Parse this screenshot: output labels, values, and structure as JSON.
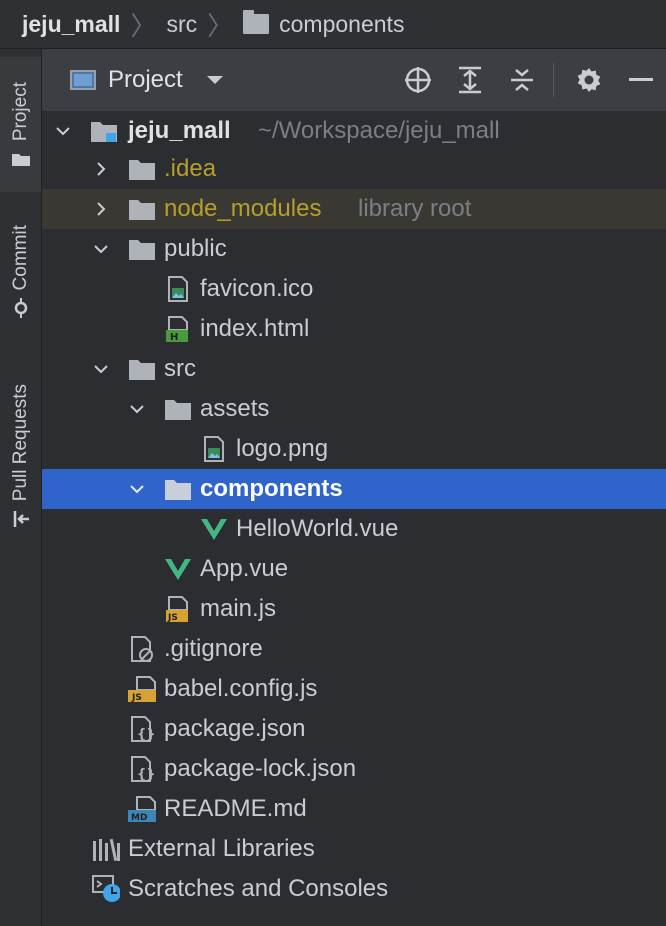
{
  "breadcrumb": {
    "project": "jeju_mall",
    "folder1": "src",
    "folder2": "components"
  },
  "sidebar": {
    "tabs": [
      "Project",
      "Commit",
      "Pull Requests"
    ]
  },
  "toolbar": {
    "title": "Project"
  },
  "tree": {
    "root_name": "jeju_mall",
    "root_path": "~/Workspace/jeju_mall",
    "idea": ".idea",
    "node_modules": "node_modules",
    "node_modules_hint": "library root",
    "public": "public",
    "favicon": "favicon.ico",
    "index_html": "index.html",
    "src": "src",
    "assets": "assets",
    "logo": "logo.png",
    "components": "components",
    "hello_world": "HelloWorld.vue",
    "app_vue": "App.vue",
    "main_js": "main.js",
    "gitignore": ".gitignore",
    "babel": "babel.config.js",
    "package_json": "package.json",
    "package_lock": "package-lock.json",
    "readme": "README.md",
    "external": "External Libraries",
    "scratches": "Scratches and Consoles"
  },
  "colors": {
    "selection": "#2f65ca",
    "vue_green": "#41b883",
    "excluded_olive": "#b5a02d"
  }
}
